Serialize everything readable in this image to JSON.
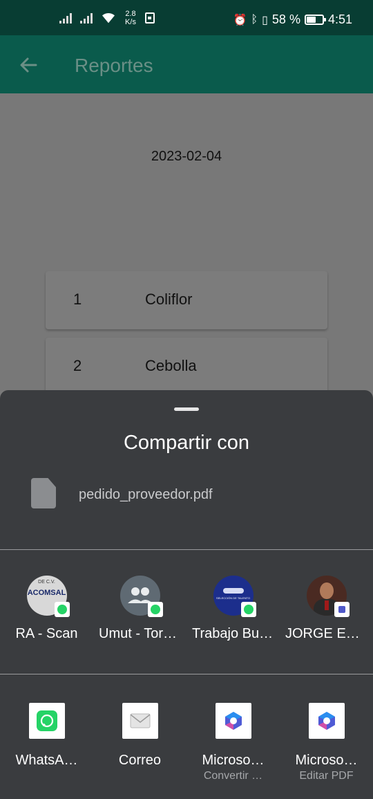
{
  "status_bar": {
    "speed_value": "2.8",
    "speed_unit": "K/s",
    "battery": "58 %",
    "battery_level": 0.58,
    "time": "4:51"
  },
  "app_bar": {
    "title": "Reportes",
    "back_icon": "arrow-left-icon"
  },
  "report": {
    "date": "2023-02-04",
    "rows": [
      {
        "num": "1",
        "name": "Coliflor"
      },
      {
        "num": "2",
        "name": "Cebolla"
      }
    ]
  },
  "share_sheet": {
    "title": "Compartir con",
    "file_name": "pedido_proveedor.pdf",
    "contacts": [
      {
        "label": "RA - Scan",
        "avatar_text": "ACOMSAL",
        "avatar_caption": "DE C.V.",
        "badge": "whatsapp-badge-icon"
      },
      {
        "label": "Umut - Torku - …",
        "avatar_text": "",
        "badge": "whatsapp-badge-icon"
      },
      {
        "label": "Trabajo Bussine…",
        "avatar_text": "SELECCIÓN DE TALENTO",
        "badge": "whatsapp-badge-icon"
      },
      {
        "label": "JORGE EDWIN …",
        "avatar_text": "",
        "badge": "teams-badge-icon"
      }
    ],
    "apps": [
      {
        "label": "WhatsA…",
        "sub": "",
        "icon": "whatsapp-icon"
      },
      {
        "label": "Correo",
        "sub": "",
        "icon": "mail-icon"
      },
      {
        "label": "Microso…",
        "sub": "Convertir …",
        "icon": "microsoft-365-icon"
      },
      {
        "label": "Microso…",
        "sub": "Editar PDF",
        "icon": "microsoft-365-icon"
      }
    ]
  },
  "colors": {
    "status_bar": "#083d33",
    "app_bar": "#0a5b4c",
    "sheet_bg": "#3a3c3f",
    "whatsapp_green": "#25d366"
  }
}
